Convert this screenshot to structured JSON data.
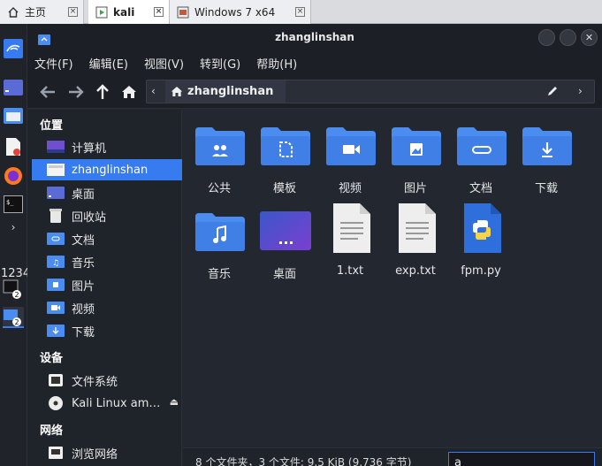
{
  "vm_tabs": [
    {
      "label": "主页",
      "icon": "home-icon"
    },
    {
      "label": "kali",
      "icon": "vm-running-icon",
      "active": true
    },
    {
      "label": "Windows 7 x64",
      "icon": "vm-icon"
    }
  ],
  "dock": {
    "workspaces": "1234",
    "badges": [
      "2",
      "2"
    ]
  },
  "window": {
    "title": "zhanglinshan",
    "menu": [
      "文件(F)",
      "编辑(E)",
      "视图(V)",
      "转到(G)",
      "帮助(H)"
    ],
    "path_label": "zhanglinshan"
  },
  "sidebar": {
    "heading_places": "位置",
    "places": [
      {
        "label": "计算机",
        "icon": "computer-icon"
      },
      {
        "label": "zhanglinshan",
        "icon": "home-folder-icon",
        "selected": true
      },
      {
        "label": "桌面",
        "icon": "desktop-icon"
      },
      {
        "label": "回收站",
        "icon": "trash-icon"
      },
      {
        "label": "文档",
        "icon": "documents-icon"
      },
      {
        "label": "音乐",
        "icon": "music-icon"
      },
      {
        "label": "图片",
        "icon": "pictures-icon"
      },
      {
        "label": "视频",
        "icon": "videos-icon"
      },
      {
        "label": "下载",
        "icon": "downloads-icon"
      }
    ],
    "heading_devices": "设备",
    "devices": [
      {
        "label": "文件系统",
        "icon": "drive-icon"
      },
      {
        "label": "Kali Linux am…",
        "icon": "disc-icon"
      }
    ],
    "heading_network": "网络",
    "network": [
      {
        "label": "浏览网络",
        "icon": "network-icon"
      }
    ]
  },
  "files": [
    {
      "name": "公共",
      "icon": "public-folder-icon"
    },
    {
      "name": "模板",
      "icon": "templates-folder-icon"
    },
    {
      "name": "视频",
      "icon": "videos-folder-icon"
    },
    {
      "name": "图片",
      "icon": "pictures-folder-icon"
    },
    {
      "name": "文档",
      "icon": "documents-folder-icon"
    },
    {
      "name": "下载",
      "icon": "downloads-folder-icon"
    },
    {
      "name": "音乐",
      "icon": "music-folder-icon"
    },
    {
      "name": "桌面",
      "icon": "desktop-folder-icon"
    },
    {
      "name": "1.txt",
      "icon": "text-file-icon"
    },
    {
      "name": "exp.txt",
      "icon": "text-file-icon"
    },
    {
      "name": "fpm.py",
      "icon": "python-file-icon"
    }
  ],
  "status": {
    "text": "8 个文件夹，3 个文件: 9.5 KiB (9,736 字节)",
    "search_value": "a"
  },
  "colors": {
    "accent": "#367bf0",
    "folder": "#4a8cf0"
  }
}
